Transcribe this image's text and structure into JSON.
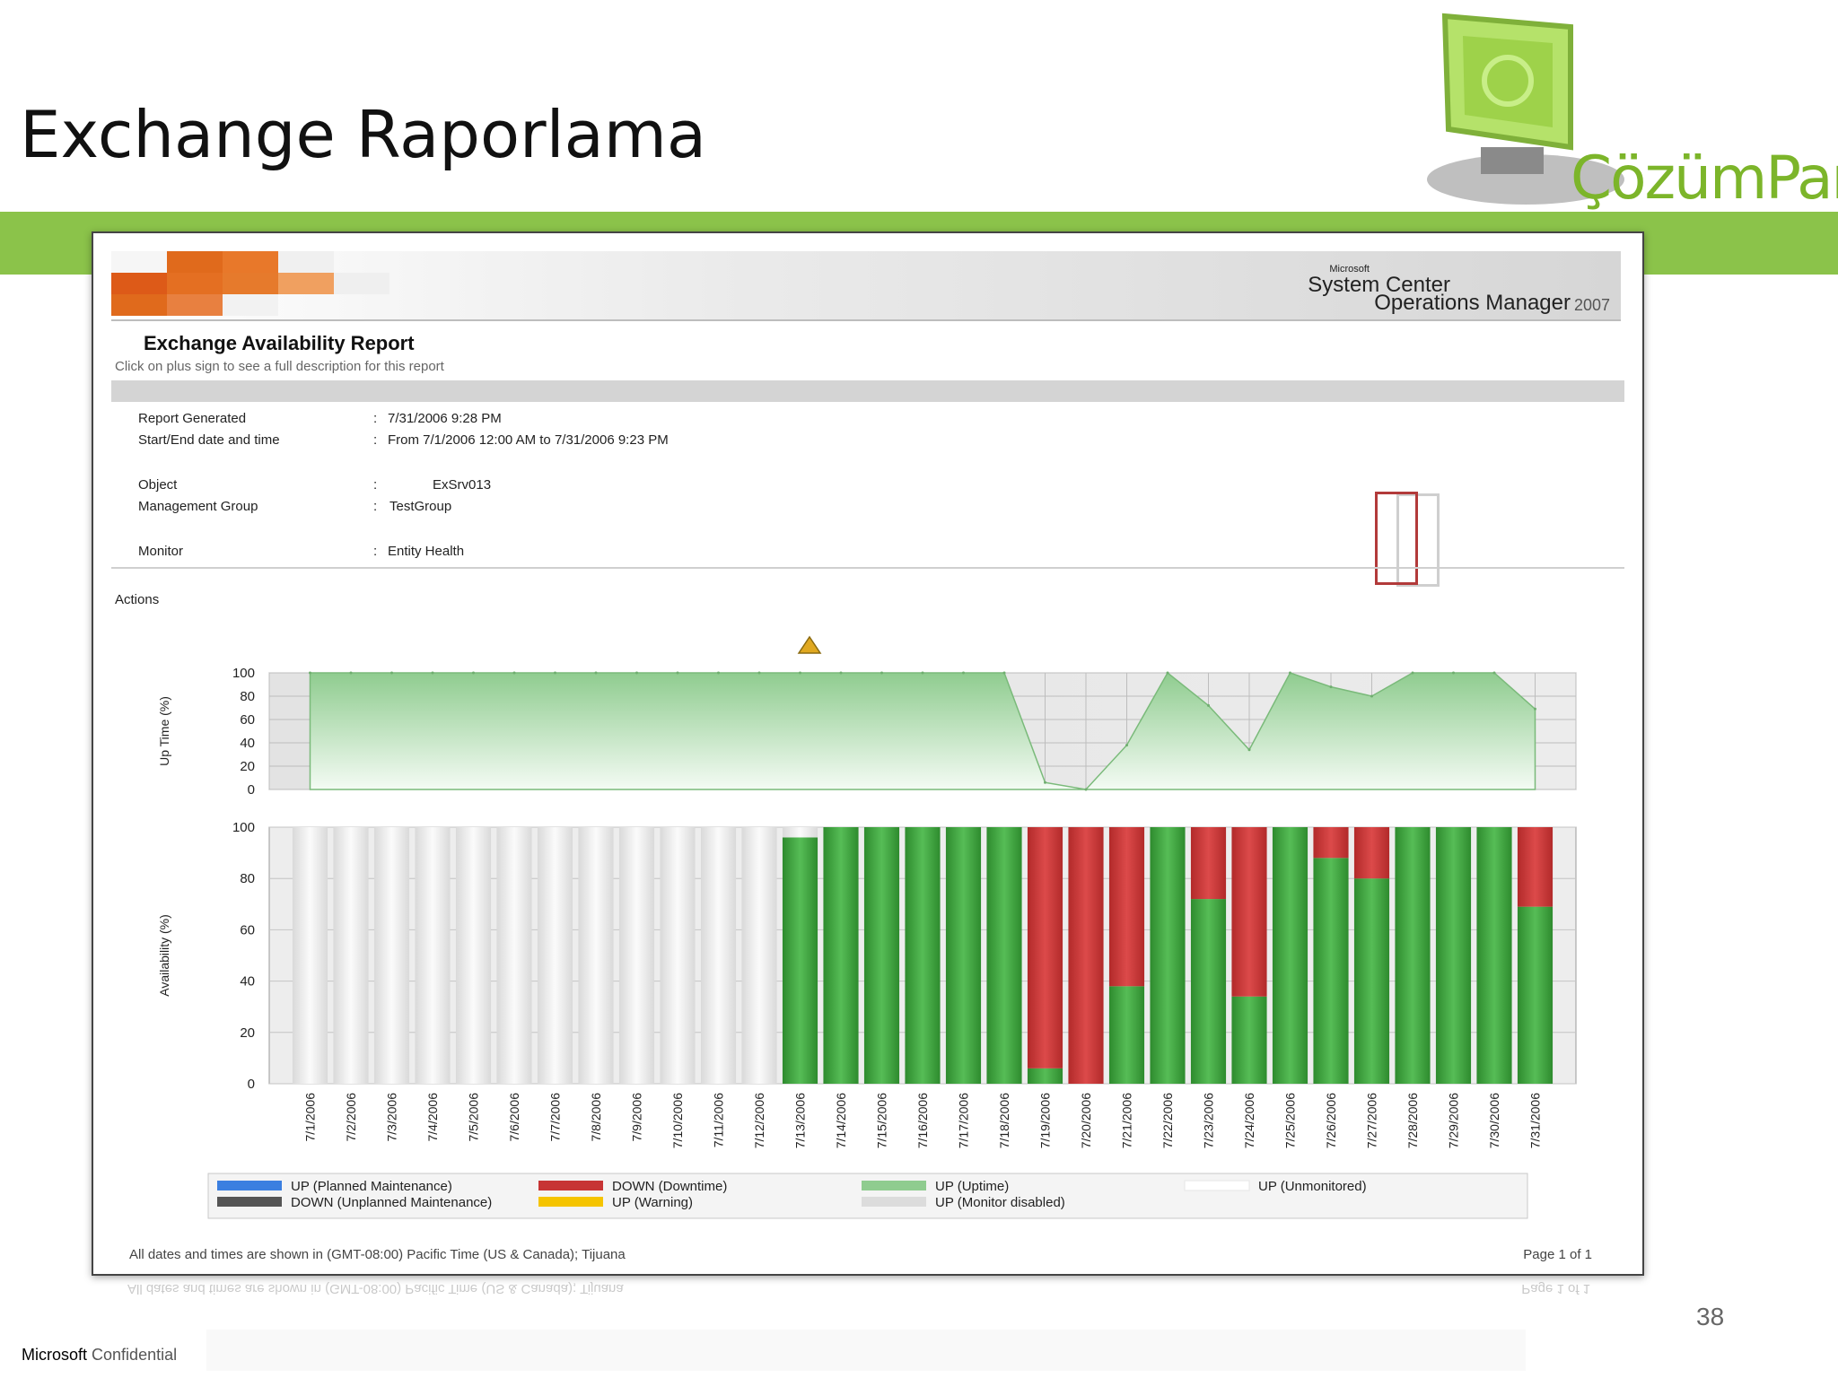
{
  "slide": {
    "title": "Exchange Raporlama",
    "logo_text": "ÇözümPark",
    "slide_number": "38",
    "confidential_brand": "Microsoft",
    "confidential_label": "Confidential"
  },
  "report": {
    "vendor_small": "Microsoft",
    "product_line1": "System Center",
    "product_line2": "Operations Manager",
    "product_year": "2007",
    "title": "Exchange Availability Report",
    "subtitle": "Click on plus sign to see a full description for this report",
    "fields": [
      {
        "label": "Report Generated",
        "value": "7/31/2006 9:28 PM"
      },
      {
        "label": "Start/End date and time",
        "value": "From 7/1/2006 12:00 AM to 7/31/2006 9:23 PM"
      },
      {
        "label": "Object",
        "value": "ExSrv013"
      },
      {
        "label": "Management Group",
        "value": "TestGroup"
      },
      {
        "label": "Monitor",
        "value": "Entity Health"
      }
    ],
    "colon": ":",
    "actions_label": "Actions",
    "footnote": "All dates and times are shown in (GMT-08:00) Pacific Time (US & Canada); Tijuana",
    "page": "Page 1 of 1"
  },
  "colors": {
    "uptime": "#3fa33f",
    "downtime": "#c73434",
    "unmonitored": "#f2f2f2",
    "planned": "#3b7fe0",
    "unplanned": "#555555",
    "warning": "#f5c400",
    "disabled": "#dcdcdc",
    "area": "#a9d9a9",
    "accent_band": "#8bc34a"
  },
  "chart_data": [
    {
      "type": "area",
      "ylabel": "Up Time (%)",
      "ylim": [
        0,
        100
      ],
      "yticks": [
        0,
        20,
        40,
        60,
        80,
        100
      ],
      "grid": true,
      "x": [
        "7/1/2006",
        "7/2/2006",
        "7/3/2006",
        "7/4/2006",
        "7/5/2006",
        "7/6/2006",
        "7/7/2006",
        "7/8/2006",
        "7/9/2006",
        "7/10/2006",
        "7/11/2006",
        "7/12/2006",
        "7/13/2006",
        "7/14/2006",
        "7/15/2006",
        "7/16/2006",
        "7/17/2006",
        "7/18/2006",
        "7/19/2006",
        "7/20/2006",
        "7/21/2006",
        "7/22/2006",
        "7/23/2006",
        "7/24/2006",
        "7/25/2006",
        "7/26/2006",
        "7/27/2006",
        "7/28/2006",
        "7/29/2006",
        "7/30/2006",
        "7/31/2006"
      ],
      "values": [
        100,
        100,
        100,
        100,
        100,
        100,
        100,
        100,
        100,
        100,
        100,
        100,
        100,
        100,
        100,
        100,
        100,
        100,
        6,
        0,
        38,
        100,
        72,
        34,
        100,
        88,
        80,
        100,
        100,
        100,
        69
      ]
    },
    {
      "type": "bar",
      "stacked": true,
      "ylabel": "Availability (%)",
      "ylim": [
        0,
        100
      ],
      "yticks": [
        0,
        20,
        40,
        60,
        80,
        100
      ],
      "grid": true,
      "categories": [
        "7/1/2006",
        "7/2/2006",
        "7/3/2006",
        "7/4/2006",
        "7/5/2006",
        "7/6/2006",
        "7/7/2006",
        "7/8/2006",
        "7/9/2006",
        "7/10/2006",
        "7/11/2006",
        "7/12/2006",
        "7/13/2006",
        "7/14/2006",
        "7/15/2006",
        "7/16/2006",
        "7/17/2006",
        "7/18/2006",
        "7/19/2006",
        "7/20/2006",
        "7/21/2006",
        "7/22/2006",
        "7/23/2006",
        "7/24/2006",
        "7/25/2006",
        "7/26/2006",
        "7/27/2006",
        "7/28/2006",
        "7/29/2006",
        "7/30/2006",
        "7/31/2006"
      ],
      "series": [
        {
          "name": "UP (Uptime)",
          "color": "#3fa33f",
          "values": [
            0,
            0,
            0,
            0,
            0,
            0,
            0,
            0,
            0,
            0,
            0,
            0,
            96,
            100,
            100,
            100,
            100,
            100,
            6,
            0,
            38,
            100,
            72,
            34,
            100,
            88,
            80,
            100,
            100,
            100,
            69
          ]
        },
        {
          "name": "DOWN (Downtime)",
          "color": "#c73434",
          "values": [
            0,
            0,
            0,
            0,
            0,
            0,
            0,
            0,
            0,
            0,
            0,
            0,
            0,
            0,
            0,
            0,
            0,
            0,
            94,
            100,
            62,
            0,
            28,
            66,
            0,
            12,
            20,
            0,
            0,
            0,
            31
          ]
        },
        {
          "name": "UP (Unmonitored)",
          "color": "#f2f2f2",
          "values": [
            100,
            100,
            100,
            100,
            100,
            100,
            100,
            100,
            100,
            100,
            100,
            100,
            4,
            0,
            0,
            0,
            0,
            0,
            0,
            0,
            0,
            0,
            0,
            0,
            0,
            0,
            0,
            0,
            0,
            0,
            0
          ]
        }
      ],
      "legend": {
        "placement": "bottom",
        "items": [
          {
            "label": "UP (Planned Maintenance)",
            "color": "#3b7fe0"
          },
          {
            "label": "DOWN (Downtime)",
            "color": "#c73434"
          },
          {
            "label": "UP (Uptime)",
            "color": "#8fcc8f"
          },
          {
            "label": "UP (Unmonitored)",
            "color": "#ffffff"
          },
          {
            "label": "DOWN (Unplanned Maintenance)",
            "color": "#555555"
          },
          {
            "label": "UP (Warning)",
            "color": "#f5c400"
          },
          {
            "label": "UP (Monitor disabled)",
            "color": "#dcdcdc"
          }
        ]
      }
    }
  ]
}
